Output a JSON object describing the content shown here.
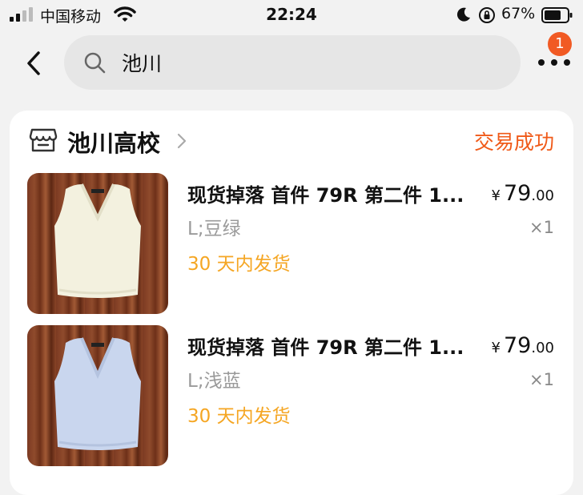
{
  "status_bar": {
    "carrier": "中国移动",
    "time": "22:24",
    "battery_pct": "67%"
  },
  "search": {
    "query": "池川"
  },
  "more_badge": "1",
  "order": {
    "shop_name": "池川高校",
    "status": "交易成功",
    "items": [
      {
        "title": "现货掉落 首件 79R 第二件 1...",
        "spec": "L;豆绿",
        "shipping": "30 天内发货",
        "currency": "¥",
        "price_int": "79",
        "price_dec": ".00",
        "qty": "×1"
      },
      {
        "title": "现货掉落 首件 79R 第二件 1...",
        "spec": "L;浅蓝",
        "shipping": "30 天内发货",
        "currency": "¥",
        "price_int": "79",
        "price_dec": ".00",
        "qty": "×1"
      }
    ]
  },
  "colors": {
    "accent": "#f05a19",
    "shipping": "#f5a623",
    "badge": "#f15a24",
    "vest_1": "#f3f1df",
    "vest_2": "#c9d6ee"
  },
  "icons": [
    "signal-icon",
    "wifi-icon",
    "moon-icon",
    "rotation-lock-icon",
    "battery-icon",
    "back-arrow-icon",
    "search-icon",
    "more-icon",
    "shop-icon",
    "chevron-right-icon"
  ]
}
